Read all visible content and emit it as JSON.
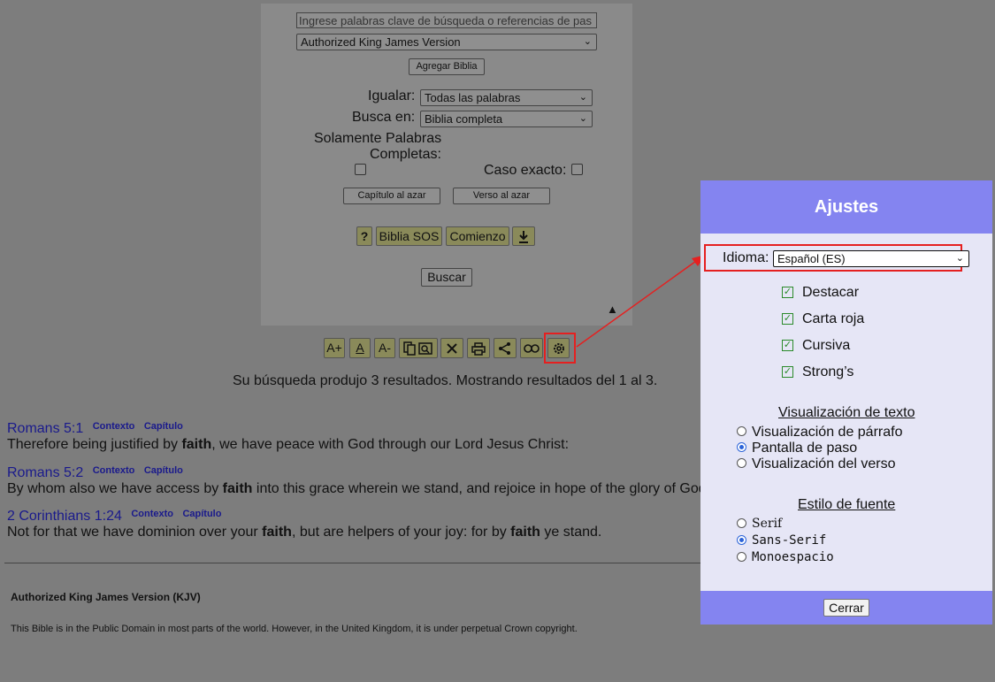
{
  "search": {
    "query_placeholder": "Ingrese palabras clave de búsqueda o referencias de pas",
    "version_selected": "Authorized King James Version",
    "add_bible_label": "Agregar Biblia",
    "match_label": "Igualar:",
    "match_selected": "Todas las palabras",
    "search_in_label": "Busca en:",
    "search_in_selected": "Biblia completa",
    "whole_words_label_1": "Solamente Palabras",
    "whole_words_label_2": "Completas:",
    "exact_case_label": "Caso exacto:",
    "random_chapter_label": "Capítulo al azar",
    "random_verse_label": "Verso al azar",
    "help_label": "?",
    "sos_label": "Biblia SOS",
    "start_label": "Comienzo",
    "search_button_label": "Buscar",
    "collapse_glyph": "▲"
  },
  "toolbar": {
    "font_larger": "A+",
    "font_normal": "A",
    "font_smaller": "A-",
    "icons": [
      "copy-icon",
      "clear-icon",
      "print-icon",
      "share-icon",
      "link-icon",
      "gear-icon"
    ]
  },
  "results": {
    "summary": "Su búsqueda produjo 3 resultados.  Mostrando resultados del 1 al 3.",
    "items": [
      {
        "ref": "Romans 5:1",
        "context": "Contexto",
        "chapter": "Capítulo",
        "before": "Therefore being justified by ",
        "keyword": "faith",
        "after": ", we have peace with God through our Lord Jesus Christ:"
      },
      {
        "ref": "Romans 5:2",
        "context": "Contexto",
        "chapter": "Capítulo",
        "before": "By whom also we have access by ",
        "keyword": "faith",
        "after": " into this grace wherein we stand, and rejoice in hope of the glory of God."
      },
      {
        "ref": "2 Corinthians 1:24",
        "context": "Contexto",
        "chapter": "Capítulo",
        "before": "Not for that we have dominion over your ",
        "keyword": "faith",
        "mid": ", but are helpers of your joy: for by ",
        "keyword2": "faith",
        "after": " ye stand."
      }
    ]
  },
  "footer": {
    "version_title": "Authorized King James Version (KJV)",
    "copyright": "This Bible is in the Public Domain in most parts of the world.  However, in the United Kingdom, it is under perpetual Crown copyright."
  },
  "settings": {
    "title": "Ajustes",
    "language_label": "Idioma:",
    "language_selected": "Español (ES)",
    "toggles": [
      {
        "label": "Destacar",
        "checked": true
      },
      {
        "label": "Carta roja",
        "checked": true
      },
      {
        "label": "Cursiva",
        "checked": true
      },
      {
        "label": "Strong’s",
        "checked": true
      }
    ],
    "text_display_heading": "Visualización de texto",
    "text_display_options": [
      "Visualización de párrafo",
      "Pantalla de paso",
      "Visualización del verso"
    ],
    "text_display_selected": "Pantalla de paso",
    "font_style_heading": "Estilo de fuente",
    "font_style_options": [
      "Serif",
      "Sans-Serif",
      "Monoespacio"
    ],
    "font_style_selected": "Sans-Serif",
    "close_label": "Cerrar"
  },
  "colors": {
    "overlay": "#7d7d7d",
    "dialog_header": "#8484f0",
    "dialog_body": "#e6e6f6",
    "annotation_red": "#e52020",
    "link_blue": "#1a1a8c"
  }
}
